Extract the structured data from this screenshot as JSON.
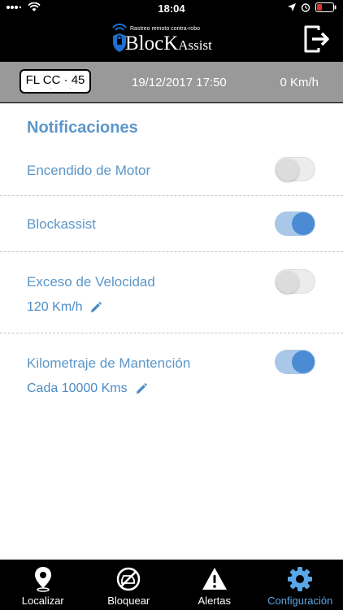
{
  "status_bar": {
    "time": "18:04"
  },
  "header": {
    "logo_tagline": "Rastreo remoto contra-robo",
    "logo_brand_main": "BlocK",
    "logo_brand_sub": "Assist"
  },
  "info_bar": {
    "plate": "FL CC · 45",
    "datetime": "19/12/2017 17:50",
    "speed": "0 Km/h"
  },
  "notifications": {
    "title": "Notificaciones",
    "items": [
      {
        "label": "Encendido de Motor",
        "enabled": false
      },
      {
        "label": "Blockassist",
        "enabled": true
      },
      {
        "label": "Exceso de Velocidad",
        "enabled": false,
        "detail": "120 Km/h"
      },
      {
        "label": "Kilometraje de Mantención",
        "enabled": true,
        "detail": "Cada 10000 Kms"
      }
    ]
  },
  "tabs": [
    {
      "label": "Localizar",
      "icon": "location-pin-icon",
      "active": false
    },
    {
      "label": "Bloquear",
      "icon": "block-car-icon",
      "active": false
    },
    {
      "label": "Alertas",
      "icon": "warning-icon",
      "active": false
    },
    {
      "label": "Configuración",
      "icon": "gear-icon",
      "active": true
    }
  ],
  "colors": {
    "accent": "#5b96c9",
    "active_tab": "#5aa6e6",
    "toggle_on_track": "#a9c8e8",
    "toggle_on_knob": "#4a8bd4",
    "info_bar": "#999999"
  }
}
